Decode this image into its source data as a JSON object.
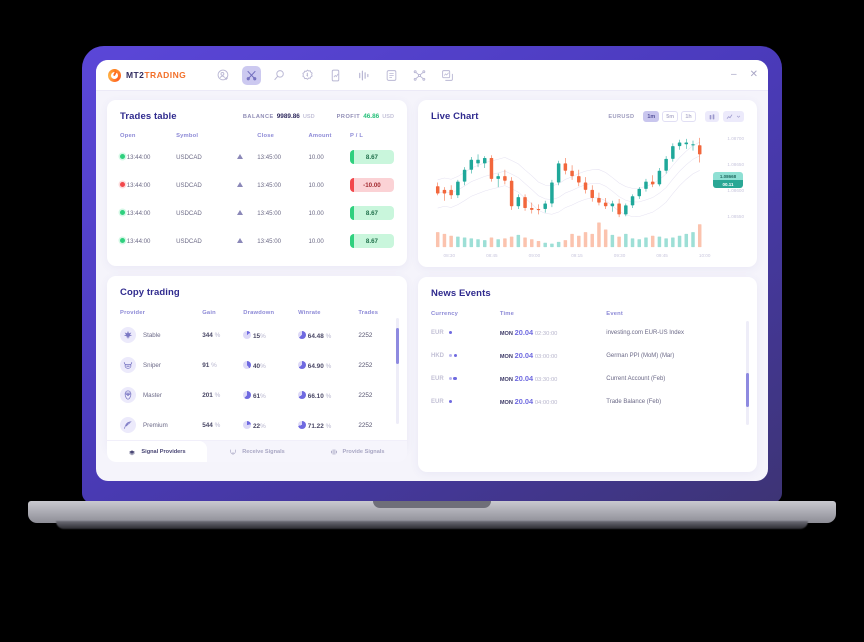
{
  "app": {
    "logo_primary": "MT2",
    "logo_secondary": "TRADING",
    "minimize_label": "–",
    "close_label": "✕",
    "toolbar_icons": [
      {
        "name": "add-user-icon",
        "active": false
      },
      {
        "name": "tools-crossed-icon",
        "active": true
      },
      {
        "name": "search-money-icon",
        "active": false
      },
      {
        "name": "dollar-badge-icon",
        "active": false
      },
      {
        "name": "mobile-chart-icon",
        "active": false
      },
      {
        "name": "bars-signal-icon",
        "active": false
      },
      {
        "name": "notes-icon",
        "active": false
      },
      {
        "name": "network-nodes-icon",
        "active": false
      },
      {
        "name": "copy-chart-icon",
        "active": false
      }
    ]
  },
  "trades": {
    "title": "Trades table",
    "balance_label": "BALANCE",
    "balance_value": "9989.86",
    "balance_currency": "USD",
    "profit_label": "PROFIT",
    "profit_value": "46.86",
    "profit_currency": "USD",
    "profit_color": "#27c07a",
    "columns": [
      "Open",
      "Symbol",
      "",
      "Close",
      "Amount",
      "P / L"
    ],
    "rows": [
      {
        "status": "up",
        "open": "13:44:00",
        "symbol": "USDCAD",
        "close": "13:45:00",
        "amount": "10.00",
        "pl": "8.67",
        "pl_sign": "pos"
      },
      {
        "status": "down",
        "open": "13:44:00",
        "symbol": "USDCAD",
        "close": "13:45:00",
        "amount": "10.00",
        "pl": "-10.00",
        "pl_sign": "neg"
      },
      {
        "status": "up",
        "open": "13:44:00",
        "symbol": "USDCAD",
        "close": "13:45:00",
        "amount": "10.00",
        "pl": "8.67",
        "pl_sign": "pos"
      },
      {
        "status": "up",
        "open": "13:44:00",
        "symbol": "USDCAD",
        "close": "13:45:00",
        "amount": "10.00",
        "pl": "8.67",
        "pl_sign": "pos"
      }
    ]
  },
  "copy_trading": {
    "title": "Copy trading",
    "columns": [
      "Provider",
      "Gain",
      "Drawdown",
      "Winrate",
      "Trades"
    ],
    "rows": [
      {
        "icon": "shuriken-icon",
        "name": "Stable",
        "gain": "344",
        "gain_unit": "%",
        "drawdown": "15",
        "drawdown_unit": "%",
        "drawdown_pct": 15,
        "winrate": "64.48",
        "winrate_unit": "%",
        "winrate_pct": 64,
        "trades": "2252"
      },
      {
        "icon": "bull-icon",
        "name": "Sniper",
        "gain": "91",
        "gain_unit": "%",
        "drawdown": "40",
        "drawdown_unit": "%",
        "drawdown_pct": 40,
        "winrate": "64.90",
        "winrate_unit": "%",
        "winrate_pct": 65,
        "trades": "2252"
      },
      {
        "icon": "owl-icon",
        "name": "Master",
        "gain": "201",
        "gain_unit": "%",
        "drawdown": "61",
        "drawdown_unit": "%",
        "drawdown_pct": 61,
        "winrate": "66.10",
        "winrate_unit": "%",
        "winrate_pct": 66,
        "trades": "2252"
      },
      {
        "icon": "feather-icon",
        "name": "Premium",
        "gain": "544",
        "gain_unit": "%",
        "drawdown": "22",
        "drawdown_unit": "%",
        "drawdown_pct": 22,
        "winrate": "71.22",
        "winrate_unit": "%",
        "winrate_pct": 71,
        "trades": "2252"
      }
    ],
    "tabs": [
      {
        "label": "Signal Providers",
        "icon": "broadcast-icon",
        "active": true
      },
      {
        "label": "Receive Signals",
        "icon": "receive-icon",
        "active": false
      },
      {
        "label": "Provide Signals",
        "icon": "provide-icon",
        "active": false
      }
    ]
  },
  "live_chart": {
    "title": "Live Chart",
    "pair": "EURUSD",
    "timeframes": [
      {
        "label": "1m",
        "active": true
      },
      {
        "label": "5m",
        "active": false
      },
      {
        "label": "1h",
        "active": false
      }
    ],
    "controls": [
      {
        "name": "candlestick-toggle-icon"
      },
      {
        "name": "line-chart-dropdown-icon"
      }
    ],
    "price_tag": {
      "price": "1.08668",
      "change": "00.11"
    }
  },
  "news": {
    "title": "News Events",
    "columns": [
      "Currency",
      "Time",
      "Event"
    ],
    "rows": [
      {
        "currency": "EUR",
        "impact": 1,
        "day": "MON",
        "date": "20.04",
        "time": "02:30:00",
        "event": "investing.com EUR-US Index"
      },
      {
        "currency": "HKD",
        "impact": 2,
        "day": "MON",
        "date": "20.04",
        "time": "03:00:00",
        "event": "German PPI (MoM) (Mar)"
      },
      {
        "currency": "EUR",
        "impact": 2,
        "day": "MON",
        "date": "20.04",
        "time": "03:30:00",
        "event": "Current Account (Feb)"
      },
      {
        "currency": "EUR",
        "impact": 1,
        "day": "MON",
        "date": "20.04",
        "time": "04:00:00",
        "event": "Trade Balance (Feb)"
      }
    ]
  },
  "chart_data": {
    "type": "candlestick",
    "title": "Live Chart",
    "symbol": "EURUSD",
    "timeframe": "1m",
    "xlabel": "",
    "ylabel": "",
    "x_ticks": [
      "08:30",
      "08:45",
      "09:00",
      "09:15",
      "09:30",
      "09:45",
      "10:00"
    ],
    "y_ticks": [
      "1.08700",
      "1.08650",
      "1.08600",
      "1.08550"
    ],
    "ylim": [
      1.0853,
      1.0872
    ],
    "grid": false,
    "legend": "none",
    "current_price": "1.08668",
    "colors": {
      "up": "#1fa89a",
      "down": "#f2673c"
    },
    "candles": [
      {
        "o": 1.08598,
        "h": 1.08606,
        "l": 1.08578,
        "c": 1.08582,
        "dir": "down"
      },
      {
        "o": 1.08582,
        "h": 1.08596,
        "l": 1.08566,
        "c": 1.0859,
        "dir": "down"
      },
      {
        "o": 1.0859,
        "h": 1.086,
        "l": 1.0857,
        "c": 1.08578,
        "dir": "down"
      },
      {
        "o": 1.08578,
        "h": 1.08612,
        "l": 1.08572,
        "c": 1.08608,
        "dir": "up"
      },
      {
        "o": 1.08608,
        "h": 1.0864,
        "l": 1.086,
        "c": 1.08634,
        "dir": "up"
      },
      {
        "o": 1.08634,
        "h": 1.08662,
        "l": 1.08626,
        "c": 1.08656,
        "dir": "up"
      },
      {
        "o": 1.08656,
        "h": 1.08668,
        "l": 1.0864,
        "c": 1.08648,
        "dir": "up"
      },
      {
        "o": 1.08648,
        "h": 1.08664,
        "l": 1.08638,
        "c": 1.0866,
        "dir": "up"
      },
      {
        "o": 1.0866,
        "h": 1.08666,
        "l": 1.08608,
        "c": 1.08614,
        "dir": "down"
      },
      {
        "o": 1.08614,
        "h": 1.08626,
        "l": 1.08596,
        "c": 1.0862,
        "dir": "up"
      },
      {
        "o": 1.0862,
        "h": 1.08634,
        "l": 1.08602,
        "c": 1.0861,
        "dir": "down"
      },
      {
        "o": 1.0861,
        "h": 1.08618,
        "l": 1.08546,
        "c": 1.08554,
        "dir": "down"
      },
      {
        "o": 1.08554,
        "h": 1.0858,
        "l": 1.08548,
        "c": 1.08574,
        "dir": "up"
      },
      {
        "o": 1.08574,
        "h": 1.0858,
        "l": 1.08544,
        "c": 1.0855,
        "dir": "down"
      },
      {
        "o": 1.0855,
        "h": 1.08562,
        "l": 1.08538,
        "c": 1.08546,
        "dir": "down"
      },
      {
        "o": 1.08546,
        "h": 1.08558,
        "l": 1.08536,
        "c": 1.08548,
        "dir": "down"
      },
      {
        "o": 1.08548,
        "h": 1.08566,
        "l": 1.0854,
        "c": 1.0856,
        "dir": "up"
      },
      {
        "o": 1.0856,
        "h": 1.08612,
        "l": 1.08552,
        "c": 1.08606,
        "dir": "up"
      },
      {
        "o": 1.08606,
        "h": 1.08654,
        "l": 1.086,
        "c": 1.08648,
        "dir": "up"
      },
      {
        "o": 1.08648,
        "h": 1.0866,
        "l": 1.08624,
        "c": 1.08632,
        "dir": "down"
      },
      {
        "o": 1.08632,
        "h": 1.08644,
        "l": 1.08612,
        "c": 1.0862,
        "dir": "down"
      },
      {
        "o": 1.0862,
        "h": 1.08634,
        "l": 1.08598,
        "c": 1.08606,
        "dir": "down"
      },
      {
        "o": 1.08606,
        "h": 1.08618,
        "l": 1.08582,
        "c": 1.0859,
        "dir": "down"
      },
      {
        "o": 1.0859,
        "h": 1.086,
        "l": 1.08564,
        "c": 1.08572,
        "dir": "down"
      },
      {
        "o": 1.08572,
        "h": 1.08584,
        "l": 1.08556,
        "c": 1.08562,
        "dir": "down"
      },
      {
        "o": 1.08562,
        "h": 1.08572,
        "l": 1.08548,
        "c": 1.08554,
        "dir": "down"
      },
      {
        "o": 1.08554,
        "h": 1.08566,
        "l": 1.08542,
        "c": 1.0856,
        "dir": "up"
      },
      {
        "o": 1.0856,
        "h": 1.0857,
        "l": 1.0853,
        "c": 1.08536,
        "dir": "down"
      },
      {
        "o": 1.08536,
        "h": 1.0856,
        "l": 1.08532,
        "c": 1.08556,
        "dir": "up"
      },
      {
        "o": 1.08556,
        "h": 1.0858,
        "l": 1.0855,
        "c": 1.08576,
        "dir": "up"
      },
      {
        "o": 1.08576,
        "h": 1.08596,
        "l": 1.0857,
        "c": 1.08592,
        "dir": "up"
      },
      {
        "o": 1.08592,
        "h": 1.08614,
        "l": 1.08586,
        "c": 1.08608,
        "dir": "up"
      },
      {
        "o": 1.08608,
        "h": 1.08622,
        "l": 1.08596,
        "c": 1.08602,
        "dir": "down"
      },
      {
        "o": 1.08602,
        "h": 1.08638,
        "l": 1.08598,
        "c": 1.08632,
        "dir": "up"
      },
      {
        "o": 1.08632,
        "h": 1.08664,
        "l": 1.08626,
        "c": 1.08658,
        "dir": "up"
      },
      {
        "o": 1.08658,
        "h": 1.08692,
        "l": 1.08652,
        "c": 1.08686,
        "dir": "up"
      },
      {
        "o": 1.08686,
        "h": 1.087,
        "l": 1.08678,
        "c": 1.08694,
        "dir": "up"
      },
      {
        "o": 1.08694,
        "h": 1.08702,
        "l": 1.0868,
        "c": 1.0869,
        "dir": "up"
      },
      {
        "o": 1.0869,
        "h": 1.08698,
        "l": 1.08676,
        "c": 1.08688,
        "dir": "up"
      },
      {
        "o": 1.08688,
        "h": 1.08704,
        "l": 1.0865,
        "c": 1.08668,
        "dir": "down"
      }
    ],
    "volumes": [
      34,
      30,
      26,
      24,
      22,
      20,
      18,
      16,
      22,
      18,
      20,
      24,
      28,
      22,
      18,
      14,
      10,
      8,
      12,
      16,
      30,
      26,
      34,
      30,
      56,
      40,
      28,
      24,
      30,
      20,
      18,
      22,
      26,
      24,
      20,
      22,
      26,
      30,
      34,
      52
    ]
  }
}
